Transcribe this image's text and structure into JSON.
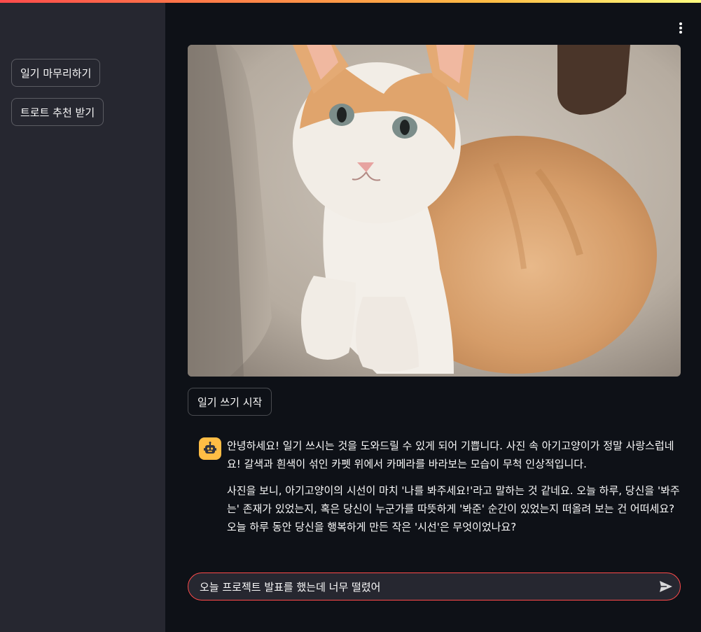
{
  "sidebar": {
    "buttons": [
      {
        "label": "일기 마무리하기"
      },
      {
        "label": "트로트 추천 받기"
      }
    ]
  },
  "main": {
    "menu_icon": "kebab-menu-icon",
    "image_subject": "kitten",
    "start_button_label": "일기 쓰기 시작",
    "assistant": {
      "avatar_icon": "robot-face-icon",
      "paragraphs": [
        "안녕하세요! 일기 쓰시는 것을 도와드릴 수 있게 되어 기쁩니다. 사진 속 아기고양이가 정말 사랑스럽네요! 갈색과 흰색이 섞인 카펫 위에서 카메라를 바라보는 모습이 무척 인상적입니다.",
        "사진을 보니, 아기고양이의 시선이 마치 '나를 봐주세요!'라고 말하는 것 같네요. 오늘 하루, 당신을 '봐주는' 존재가 있었는지, 혹은 당신이 누군가를 따뜻하게 '봐준' 순간이 있었는지 떠올려 보는 건 어떠세요? 오늘 하루 동안 당신을 행복하게 만든 작은 '시선'은 무엇이었나요?"
      ]
    },
    "chat_input": {
      "value": "오늘 프로젝트 발표를 했는데 너무 떨렸어",
      "send_icon": "send-icon"
    }
  },
  "colors": {
    "accent": "#ff4b4b",
    "avatar_bg": "#ffbd45",
    "sidebar_bg": "#262730",
    "main_bg": "#0e1117"
  }
}
